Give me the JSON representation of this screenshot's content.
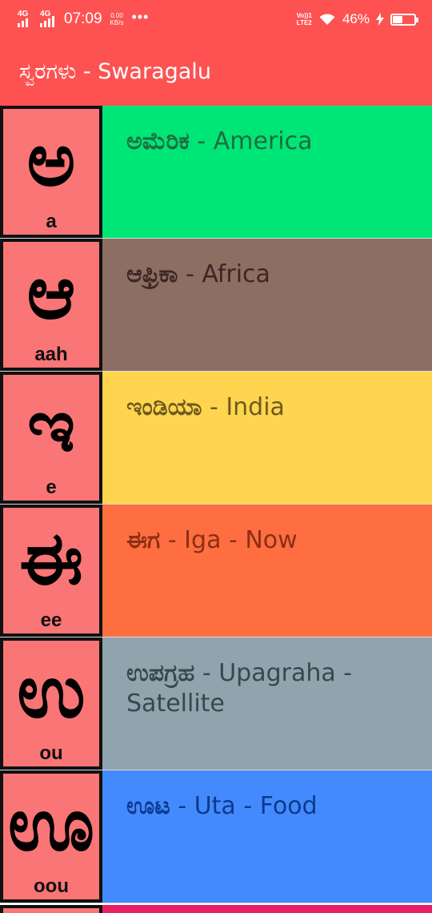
{
  "status_bar": {
    "network1": "4G",
    "network2": "4G",
    "time": "07:09",
    "speed_value": "0.00",
    "speed_unit": "KB/s",
    "more": "•••",
    "volte_top": "Vo))1",
    "volte_bottom": "LTE2",
    "battery_percent": "46%",
    "battery_level": 0.46
  },
  "app_bar": {
    "title": "ಸ್ವರಗಳು - Swaragalu"
  },
  "items": [
    {
      "glyph": "ಅ",
      "roman": "a",
      "kannada": "ಅಮೆರಿಕ",
      "text": " - America",
      "bg": "#00e676",
      "fg": "#1f6b41"
    },
    {
      "glyph": "ಆ",
      "roman": "aah",
      "kannada": "ಆಫ್ರಿಕಾ",
      "text": " - Africa",
      "bg": "#8d6e63",
      "fg": "#3e2723"
    },
    {
      "glyph": "ಇ",
      "roman": "e",
      "kannada": "ಇಂಡಿಯಾ",
      "text": " - India",
      "bg": "#ffd54f",
      "fg": "#6d5a1e"
    },
    {
      "glyph": "ಈ",
      "roman": "ee",
      "kannada": "ಈಗ",
      "text": " - Iga - Now",
      "bg": "#ff6e40",
      "fg": "#8a2f16"
    },
    {
      "glyph": "ಉ",
      "roman": "ou",
      "kannada": "ಉಪಗ್ರಹ",
      "text": " - Upagraha - Satellite",
      "bg": "#90a4ae",
      "fg": "#37474f"
    },
    {
      "glyph": "ಊ",
      "roman": "oou",
      "kannada": "ಊಟ",
      "text": " - Uta - Food",
      "bg": "#448aff",
      "fg": "#0d3a8c"
    }
  ],
  "next_item_color": "#e91e63"
}
